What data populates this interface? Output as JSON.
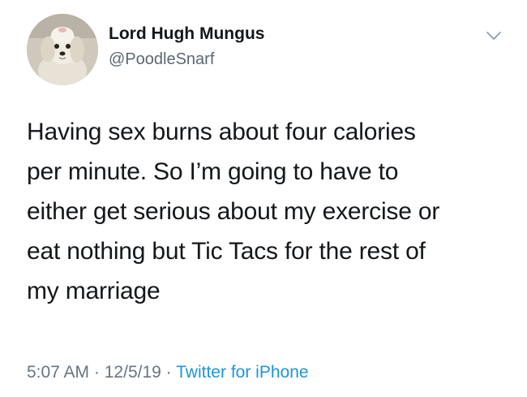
{
  "tweet": {
    "author": {
      "display_name": "Lord Hugh Mungus",
      "handle": "@PoodleSnarf",
      "avatar_icon": "poodle-avatar"
    },
    "menu_icon": "chevron-down-icon",
    "text_lines": [
      "Having sex burns about four calories",
      "per minute. So I’m going to have to",
      "either get serious about my exercise or",
      "eat nothing but Tic Tacs for the rest of",
      "my marriage"
    ],
    "time": "5:07 AM",
    "separator": "·",
    "date": "12/5/19",
    "source": "Twitter for iPhone"
  },
  "colors": {
    "text": "#14171a",
    "secondary": "#66757f",
    "link": "#1b95e0"
  }
}
